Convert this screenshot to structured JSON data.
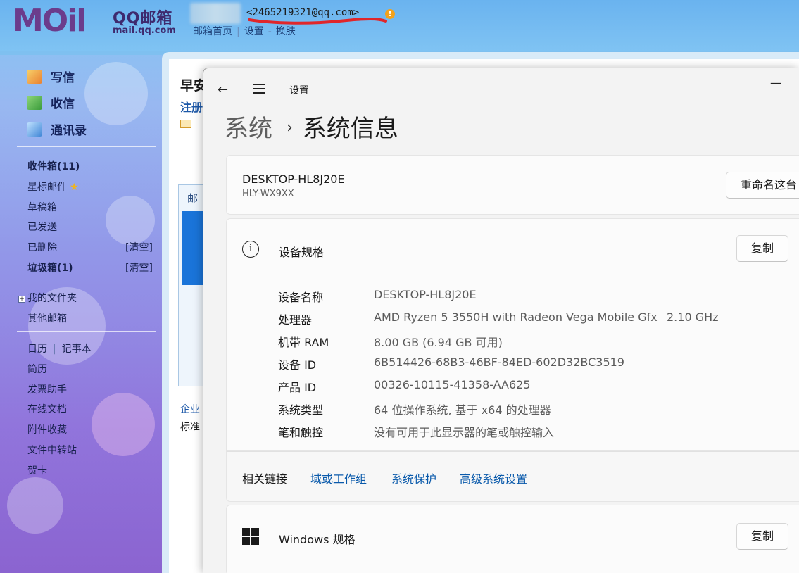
{
  "mail": {
    "logo_mark": "MOil",
    "logo_title": "QQ邮箱",
    "logo_sub": "mail.qq.com",
    "email": "<2465219321@qq.com>",
    "warn_glyph": "!",
    "top_links": [
      "邮箱首页",
      "设置",
      "换肤"
    ],
    "compose": "写信",
    "receive": "收信",
    "contacts": "通讯录",
    "folders": {
      "inbox": "收件箱(11)",
      "starred": "星标邮件",
      "drafts": "草稿箱",
      "sent": "已发送",
      "deleted": "已删除",
      "junk": "垃圾箱(1)",
      "clear": "[清空]",
      "my_folders": "我的文件夹",
      "other": "其他邮箱"
    },
    "tools": {
      "calendar": "日历",
      "notes": "记事本",
      "resume": "简历",
      "invoice": "发票助手",
      "docs": "在线文档",
      "attachments": "附件收藏",
      "transfer": "文件中转站",
      "card": "贺卡"
    },
    "bg": {
      "greet": "早安",
      "reg": "注册",
      "tab": "邮",
      "link1": "企业",
      "text2": "标准"
    }
  },
  "settings": {
    "window_title": "设置",
    "minimize": "—",
    "breadcrumb_parent": "系统",
    "breadcrumb_current": "系统信息",
    "device_name": "DESKTOP-HL8J20E",
    "device_model": "HLY-WX9XX",
    "rename_button": "重命名这台",
    "device_specs_title": "设备规格",
    "copy_label": "复制",
    "specs": [
      {
        "label": "设备名称",
        "value": "DESKTOP-HL8J20E"
      },
      {
        "label": "处理器",
        "value": "AMD Ryzen 5 3550H with Radeon Vega Mobile Gfx",
        "extra": "2.10 GHz"
      },
      {
        "label": "机带 RAM",
        "value": "8.00 GB (6.94 GB 可用)"
      },
      {
        "label": "设备 ID",
        "value": "6B514426-68B3-46BF-84ED-602D32BC3519"
      },
      {
        "label": "产品 ID",
        "value": "00326-10115-41358-AA625"
      },
      {
        "label": "系统类型",
        "value": "64 位操作系统, 基于 x64 的处理器"
      },
      {
        "label": "笔和触控",
        "value": "没有可用于此显示器的笔或触控输入"
      }
    ],
    "related_links_label": "相关链接",
    "related_links": [
      "域或工作组",
      "系统保护",
      "高级系统设置"
    ],
    "windows_specs_title": "Windows 规格"
  }
}
